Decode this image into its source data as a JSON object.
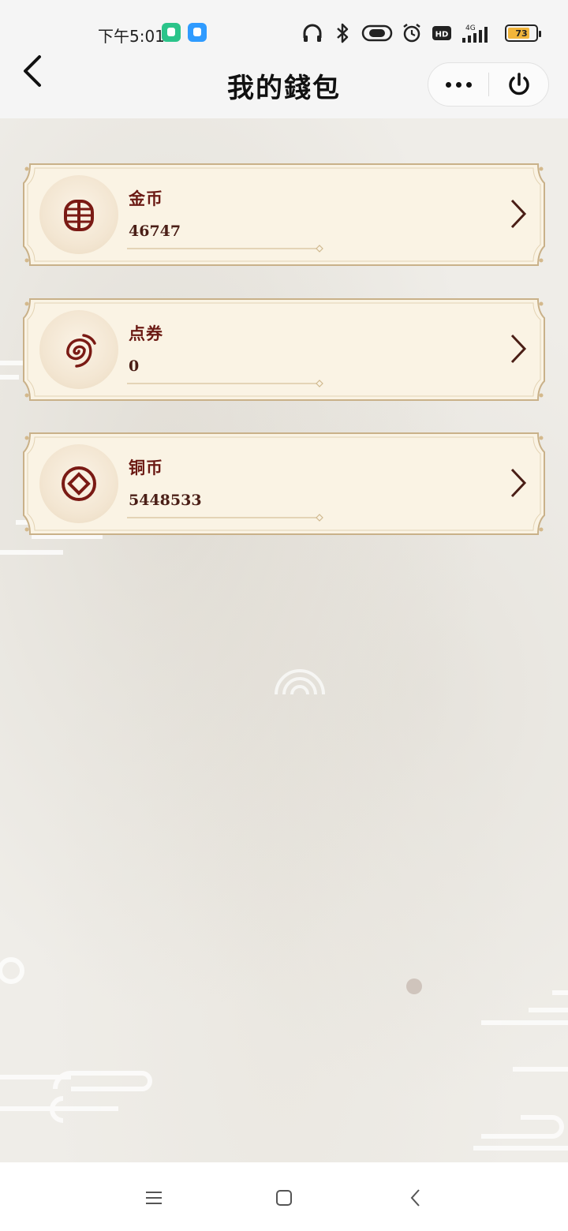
{
  "status_bar": {
    "time": "下午5:01",
    "battery_level": "73",
    "network": "4G"
  },
  "header": {
    "title": "我的錢包"
  },
  "wallet": {
    "items": [
      {
        "label": "金币",
        "value": "46747",
        "icon": "gold-coin-icon"
      },
      {
        "label": "点券",
        "value": "0",
        "icon": "voucher-swirl-icon"
      },
      {
        "label": "铜币",
        "value": "5448533",
        "icon": "copper-coin-icon"
      }
    ]
  },
  "colors": {
    "label": "#6b1a14",
    "value": "#4a1e16",
    "icon": "#7a1a14",
    "card_border": "#c9b189",
    "card_fill": "#faf3e4"
  }
}
